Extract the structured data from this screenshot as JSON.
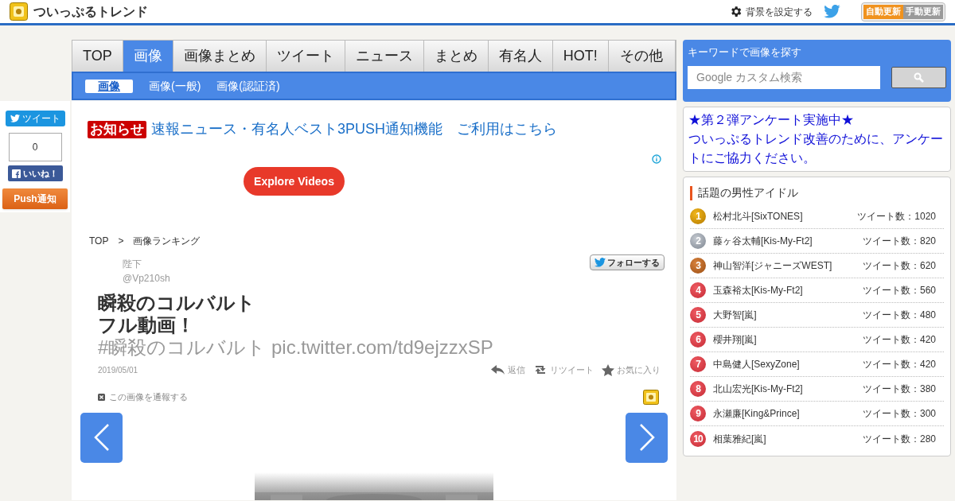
{
  "header": {
    "site_title": "ついっぷるトレンド",
    "background_link": "背景を設定する",
    "update_modes": [
      {
        "label": "自動更新",
        "selected": true
      },
      {
        "label": "手動更新",
        "selected": false
      }
    ]
  },
  "nav": {
    "tabs": [
      {
        "label": "TOP",
        "selected": false
      },
      {
        "label": "画像",
        "selected": true
      },
      {
        "label": "画像まとめ",
        "selected": false
      },
      {
        "label": "ツイート",
        "selected": false
      },
      {
        "label": "ニュース",
        "selected": false
      },
      {
        "label": "まとめ",
        "selected": false
      },
      {
        "label": "有名人",
        "selected": false
      },
      {
        "label": "HOT!",
        "selected": false
      },
      {
        "label": "その他",
        "selected": false
      }
    ],
    "subtabs": [
      {
        "label": "画像",
        "selected": true
      },
      {
        "label": "画像(一般)",
        "selected": false
      },
      {
        "label": "画像(認証済)",
        "selected": false
      }
    ]
  },
  "social": {
    "tweet_button": "ツイート",
    "like_count": "0",
    "like_button": "いいね！",
    "push_button": "Push通知"
  },
  "notice": {
    "badge": "お知らせ",
    "link": "速報ニュース・有名人ベスト3PUSH通知機能　ご利用はこちら"
  },
  "ad": {
    "button": "Explore Videos"
  },
  "breadcrumb": {
    "items": [
      "TOP",
      "画像ランキング"
    ],
    "separator": ">"
  },
  "tweet": {
    "user_name": "陛下",
    "handle": "@Vp210sh",
    "follow_button": "フォローする",
    "title_lines": [
      "瞬殺のコルバルト",
      "フル動画！"
    ],
    "body": "#瞬殺のコルバルト pic.twitter.com/td9ejzzxSP",
    "date": "2019/05/01",
    "actions": [
      {
        "kind": "reply",
        "label": "返信"
      },
      {
        "kind": "retweet",
        "label": "リツイート"
      },
      {
        "kind": "favorite",
        "label": "お気に入り"
      }
    ],
    "report_link": "この画像を通報する"
  },
  "sidebar": {
    "search": {
      "label": "キーワードで画像を探す",
      "placeholder": "Google カスタム検索"
    },
    "announcement": {
      "lines": [
        "★第２弾アンケート実施中★",
        "ついっぷるトレンド改善のために、アンケートにご協力ください。"
      ]
    },
    "ranking": {
      "title": "話題の男性アイドル",
      "rows": [
        {
          "rank": "1",
          "kind": "gold",
          "name": "松村北斗[SixTONES]",
          "count": "ツイート数：1020"
        },
        {
          "rank": "2",
          "kind": "silver",
          "name": "藤ヶ谷太輔[Kis-My-Ft2]",
          "count": "ツイート数：820"
        },
        {
          "rank": "3",
          "kind": "bronze",
          "name": "神山智洋[ジャニーズWEST]",
          "count": "ツイート数：620"
        },
        {
          "rank": "4",
          "kind": "plain",
          "name": "玉森裕太[Kis-My-Ft2]",
          "count": "ツイート数：560"
        },
        {
          "rank": "5",
          "kind": "plain",
          "name": "大野智[嵐]",
          "count": "ツイート数：480"
        },
        {
          "rank": "6",
          "kind": "plain",
          "name": "櫻井翔[嵐]",
          "count": "ツイート数：420"
        },
        {
          "rank": "7",
          "kind": "plain",
          "name": "中島健人[SexyZone]",
          "count": "ツイート数：420"
        },
        {
          "rank": "8",
          "kind": "plain",
          "name": "北山宏光[Kis-My-Ft2]",
          "count": "ツイート数：380"
        },
        {
          "rank": "9",
          "kind": "plain",
          "name": "永瀬廉[King&Prince]",
          "count": "ツイート数：300"
        },
        {
          "rank": "10",
          "kind": "plain",
          "name": "相葉雅紀[嵐]",
          "count": "ツイート数：280"
        }
      ]
    }
  }
}
